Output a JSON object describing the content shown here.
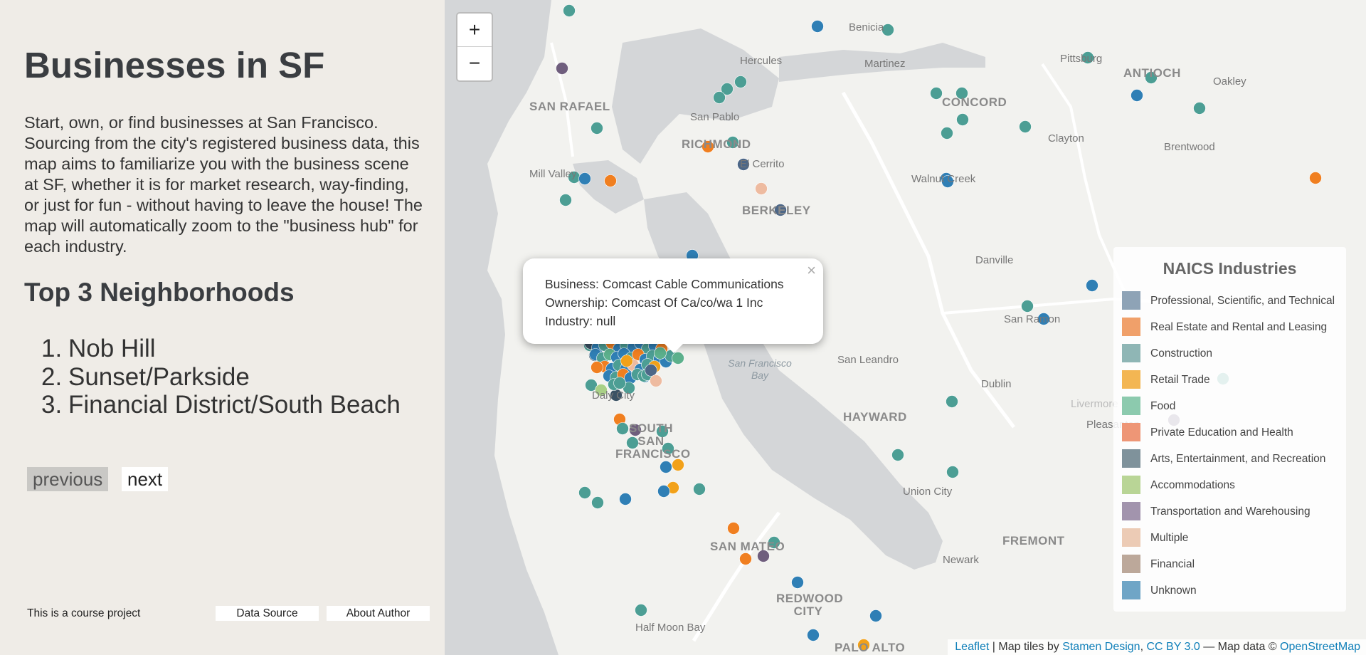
{
  "sidebar": {
    "title": "Businesses in SF",
    "intro": "Start, own, or find businesses at San Francisco. Sourcing from the city's registered business data, this map aims to familiarize you with the business scene at SF, whether it is for market research, way-finding, or just for fun - without having to leave the house! The map will automatically zoom to the \"business hub\" for each industry.",
    "neighborhoods_title": "Top 3 Neighborhoods",
    "neighborhoods": [
      {
        "num": "1.",
        "name": "Nob Hill"
      },
      {
        "num": "2.",
        "name": "Sunset/Parkside"
      },
      {
        "num": "3.",
        "name": "Financial District/South Beach"
      }
    ],
    "prev_label": "previous",
    "next_label": "next",
    "course_note": "This is a course project",
    "data_source_label": "Data Source",
    "about_author_label": "About Author"
  },
  "map": {
    "zoom_in_label": "+",
    "zoom_out_label": "−",
    "places": [
      {
        "name": "Benicia",
        "kind": "normal"
      },
      {
        "name": "Hercules",
        "kind": "normal"
      },
      {
        "name": "Martinez",
        "kind": "normal"
      },
      {
        "name": "Pittsburg",
        "kind": "normal"
      },
      {
        "name": "ANTIOCH",
        "kind": "big"
      },
      {
        "name": "Oakley",
        "kind": "normal"
      },
      {
        "name": "SAN RAFAEL",
        "kind": "big"
      },
      {
        "name": "San Pablo",
        "kind": "normal"
      },
      {
        "name": "CONCORD",
        "kind": "big"
      },
      {
        "name": "RICHMOND",
        "kind": "big"
      },
      {
        "name": "El Cerrito",
        "kind": "normal"
      },
      {
        "name": "Clayton",
        "kind": "normal"
      },
      {
        "name": "Brentwood",
        "kind": "normal"
      },
      {
        "name": "Mill Valley",
        "kind": "normal"
      },
      {
        "name": "Walnut Creek",
        "kind": "normal"
      },
      {
        "name": "BERKELEY",
        "kind": "big"
      },
      {
        "name": "Danville",
        "kind": "normal"
      },
      {
        "name": "San Ramon",
        "kind": "normal"
      },
      {
        "name": "San Leandro",
        "kind": "normal"
      },
      {
        "name": "San Francisco Bay",
        "kind": "water"
      },
      {
        "name": "Dublin",
        "kind": "normal"
      },
      {
        "name": "Livermore",
        "kind": "normal"
      },
      {
        "name": "Daly City",
        "kind": "normal"
      },
      {
        "name": "HAYWARD",
        "kind": "big"
      },
      {
        "name": "Pleasanton",
        "kind": "normal"
      },
      {
        "name": "SOUTH SAN FRANCISCO",
        "kind": "big"
      },
      {
        "name": "Union City",
        "kind": "normal"
      },
      {
        "name": "FREMONT",
        "kind": "big"
      },
      {
        "name": "SAN MATEO",
        "kind": "big"
      },
      {
        "name": "Newark",
        "kind": "normal"
      },
      {
        "name": "REDWOOD CITY",
        "kind": "big"
      },
      {
        "name": "Half Moon Bay",
        "kind": "normal"
      },
      {
        "name": "PALO ALTO",
        "kind": "big"
      }
    ],
    "popup": {
      "business": "Business: Comcast Cable Communications",
      "ownership": "Ownership: Comcast Of Ca/co/wa 1 Inc",
      "industry": "Industry: null",
      "close": "×"
    },
    "legend": {
      "title": "NAICS Industries",
      "items": [
        {
          "label": "Professional, Scientific, and Technical",
          "color": "#8ea3b6"
        },
        {
          "label": "Real Estate and Rental and Leasing",
          "color": "#f0a06a"
        },
        {
          "label": "Construction",
          "color": "#8fb6b5"
        },
        {
          "label": "Retail Trade",
          "color": "#f3b653"
        },
        {
          "label": "Food",
          "color": "#8ccaae"
        },
        {
          "label": "Private Education and Health",
          "color": "#ee9676"
        },
        {
          "label": "Arts, Entertainment, and Recreation",
          "color": "#7f929b"
        },
        {
          "label": "Accommodations",
          "color": "#b9d596"
        },
        {
          "label": "Transportation and Warehousing",
          "color": "#a294ad"
        },
        {
          "label": "Multiple",
          "color": "#eccbb5"
        },
        {
          "label": "Financial",
          "color": "#bca89a"
        },
        {
          "label": "Unknown",
          "color": "#6fa5c6"
        }
      ]
    },
    "attribution": {
      "leaflet": "Leaflet",
      "sep1": " | Map tiles by ",
      "stamen": "Stamen Design",
      "comma": ", ",
      "cc": "CC BY 3.0",
      "sep2": " — Map data © ",
      "osm": "OpenStreetMap"
    },
    "marker_colors": {
      "blue": "#2f7fb5",
      "teal": "#4c9e94",
      "orange": "#f07f20",
      "amber": "#f2a119",
      "purple": "#6f5e7d",
      "navy": "#4d6787",
      "slate": "#3b5264",
      "peach": "#eebba0",
      "lime": "#a9d086",
      "green": "#5cb08c"
    }
  }
}
